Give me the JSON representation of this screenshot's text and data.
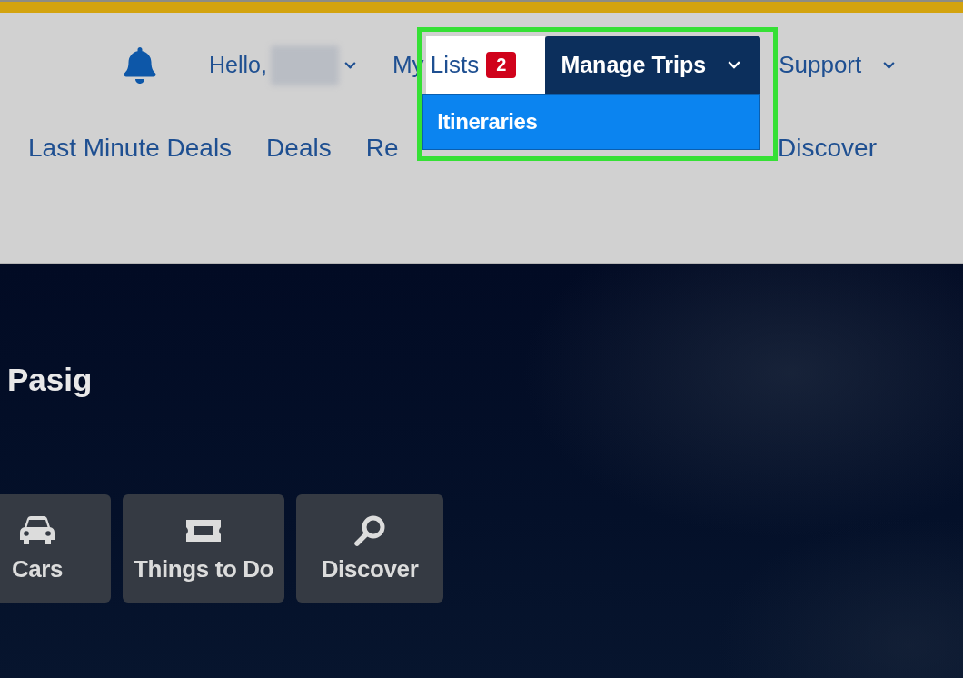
{
  "header": {
    "top_nav": {
      "greeting": "Hello,",
      "my_lists": {
        "label": "My Lists",
        "highlighted": true,
        "badge": "2"
      },
      "manage_trips": {
        "label": "Manage Trips",
        "expanded": true,
        "highlighted": true,
        "menu": [
          {
            "label": "Itineraries"
          }
        ]
      },
      "support": {
        "label": "Support"
      }
    },
    "main_nav": [
      {
        "label": "Last Minute Deals"
      },
      {
        "label": "Deals"
      },
      {
        "label": "Re"
      },
      {
        "label": "Discover"
      }
    ]
  },
  "hero": {
    "title": "Pasig",
    "tiles": [
      {
        "kind": "car",
        "label": "Cars"
      },
      {
        "kind": "ticket",
        "label": "Things to Do"
      },
      {
        "kind": "search",
        "label": "Discover"
      }
    ]
  }
}
